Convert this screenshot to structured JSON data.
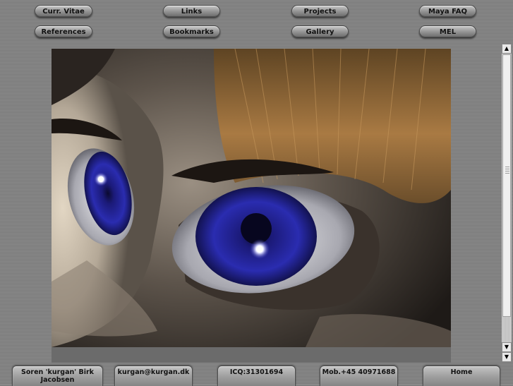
{
  "nav": {
    "row1": [
      "Curr. Vitae",
      "Links",
      "Projects",
      "Maya FAQ"
    ],
    "row2": [
      "References",
      "Bookmarks",
      "Gallery",
      "MEL"
    ]
  },
  "content": {
    "image_description": "3D rendered character face close-up with blue eyes and blond hair"
  },
  "scrollbar": {
    "up_icon": "triangle-up",
    "down_icon": "triangle-down"
  },
  "footer": {
    "name": "Soren 'kurgan' Birk Jacobsen",
    "email": "kurgan@kurgan.dk",
    "icq": "ICQ:31301694",
    "mobile": "Mob.+45 40971688",
    "home": "Home"
  },
  "colors": {
    "background_stripe_light": "#8a8a8a",
    "background_stripe_dark": "#7a7a7a",
    "eye_blue": "#2a2cb0"
  }
}
